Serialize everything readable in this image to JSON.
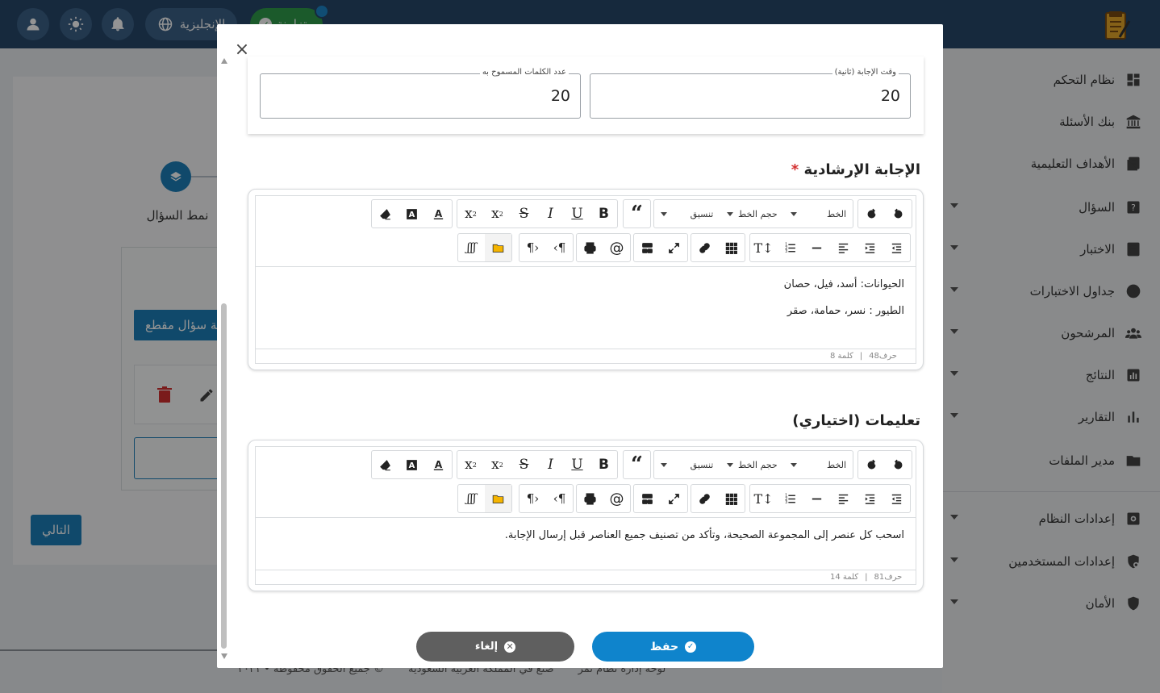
{
  "topbar": {
    "language_label": "الإنجليزية",
    "sync_label": "متزامنة",
    "icons": [
      "user-icon",
      "sun-icon",
      "bell-icon",
      "globe-icon",
      "check-circle-icon",
      "exam-logo-icon"
    ]
  },
  "sidebar": {
    "items": [
      {
        "label": "نظام التحكم",
        "icon": "dashboard-icon",
        "has_caret": false
      },
      {
        "label": "بنك الأسئلة",
        "icon": "bank-icon",
        "has_caret": false
      },
      {
        "label": "الأهداف التعليمية",
        "icon": "book-icon",
        "has_caret": false
      },
      {
        "label": "السؤال",
        "icon": "question-icon",
        "has_caret": true
      },
      {
        "label": "الاختبار",
        "icon": "exam-icon",
        "has_caret": true
      },
      {
        "label": "جداول الاختبارات",
        "icon": "clock-icon",
        "has_caret": true
      },
      {
        "label": "المرشحون",
        "icon": "users-icon",
        "has_caret": true
      },
      {
        "label": "النتائج",
        "icon": "results-icon",
        "has_caret": true
      },
      {
        "label": "التقارير",
        "icon": "reports-icon",
        "has_caret": true
      },
      {
        "label": "مدير الملفات",
        "icon": "folder-icon",
        "has_caret": false
      },
      {
        "label": "إعدادات النظام",
        "icon": "gear-icon",
        "has_caret": true
      },
      {
        "label": "إعدادات المستخدمين",
        "icon": "user-settings-icon",
        "has_caret": true
      },
      {
        "label": "الأمان",
        "icon": "shield-icon",
        "has_caret": true
      }
    ]
  },
  "background": {
    "step_label": "نمط السؤال",
    "add_section_label": "إضافة سؤال مقطع",
    "next_label": "التالي",
    "footer_brand": "لوحة إدارة نظام تمر",
    "footer_made": "صنع في المملكة العربية السعودية",
    "footer_rights": "جميع الحقوق محفوظة • ٢٠٢١ ©"
  },
  "modal": {
    "fields": {
      "answer_time_label": "وقت الإجابة (ثانية)",
      "answer_time_value": "20",
      "word_count_label": "عدد الكلمات المسموح به",
      "word_count_value": "20"
    },
    "guide_answer": {
      "title": "الإجابة الإرشادية",
      "required_mark": "*",
      "lines": [
        "الحيوانات: أسد، فيل، حصان",
        "الطيور : نسر، حمامة، صقر"
      ],
      "char_count": "حرف48",
      "word_count": "كلمة 8"
    },
    "instructions": {
      "title": "تعليمات (اختياري)",
      "lines": [
        "اسحب كل عنصر إلى المجموعة الصحيحة، وتأكد من تصنيف جميع العناصر قبل إرسال الإجابة."
      ],
      "char_count": "حرف81",
      "word_count": "كلمة 14"
    },
    "toolbar": {
      "font_label": "الخط",
      "font_size_label": "حجم الخط",
      "format_label": "تنسيق"
    },
    "save_label": "حفظ",
    "cancel_label": "إلغاء",
    "close_label": "×"
  }
}
